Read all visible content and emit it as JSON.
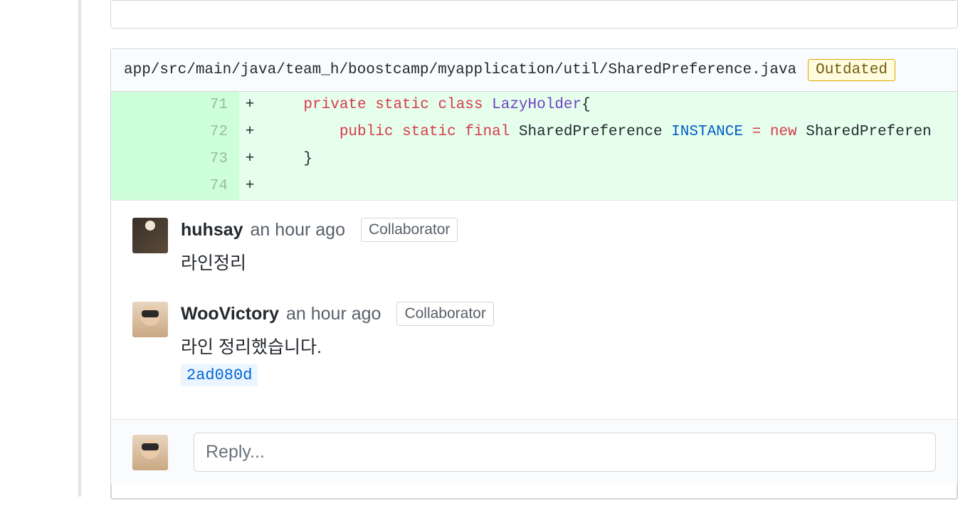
{
  "file": {
    "path": "app/src/main/java/team_h/boostcamp/myapplication/util/SharedPreference.java",
    "outdated_label": "Outdated"
  },
  "diff": {
    "lines": [
      {
        "num": "71",
        "marker": "+",
        "indent": "    ",
        "tokens": [
          [
            "kw-red",
            "private"
          ],
          [
            "",
            ""
          ],
          [
            "kw-red",
            "static"
          ],
          [
            "",
            ""
          ],
          [
            "kw-red",
            "class"
          ],
          [
            "",
            ""
          ],
          [
            "kw-purple",
            "LazyHolder"
          ],
          [
            "",
            "{"
          ]
        ]
      },
      {
        "num": "72",
        "marker": "+",
        "indent": "        ",
        "tokens": [
          [
            "kw-red",
            "public"
          ],
          [
            "",
            ""
          ],
          [
            "kw-red",
            "static"
          ],
          [
            "",
            ""
          ],
          [
            "kw-red",
            "final"
          ],
          [
            "",
            ""
          ],
          [
            "",
            "SharedPreference"
          ],
          [
            "",
            ""
          ],
          [
            "kw-blue",
            "INSTANCE"
          ],
          [
            "",
            ""
          ],
          [
            "kw-red",
            "="
          ],
          [
            "",
            ""
          ],
          [
            "kw-red",
            "new"
          ],
          [
            "",
            ""
          ],
          [
            "",
            "SharedPreferen"
          ]
        ]
      },
      {
        "num": "73",
        "marker": "+",
        "indent": "    ",
        "tokens": [
          [
            "",
            "}"
          ]
        ]
      },
      {
        "num": "74",
        "marker": "+",
        "indent": "",
        "tokens": []
      }
    ]
  },
  "comments": [
    {
      "author": "huhsay",
      "time": "an hour ago",
      "role": "Collaborator",
      "text": "라인정리",
      "avatar": "avatar-1",
      "commit": null
    },
    {
      "author": "WooVictory",
      "time": "an hour ago",
      "role": "Collaborator",
      "text": "라인 정리했습니다.",
      "avatar": "avatar-2",
      "commit": "2ad080d"
    }
  ],
  "reply": {
    "placeholder": "Reply..."
  }
}
